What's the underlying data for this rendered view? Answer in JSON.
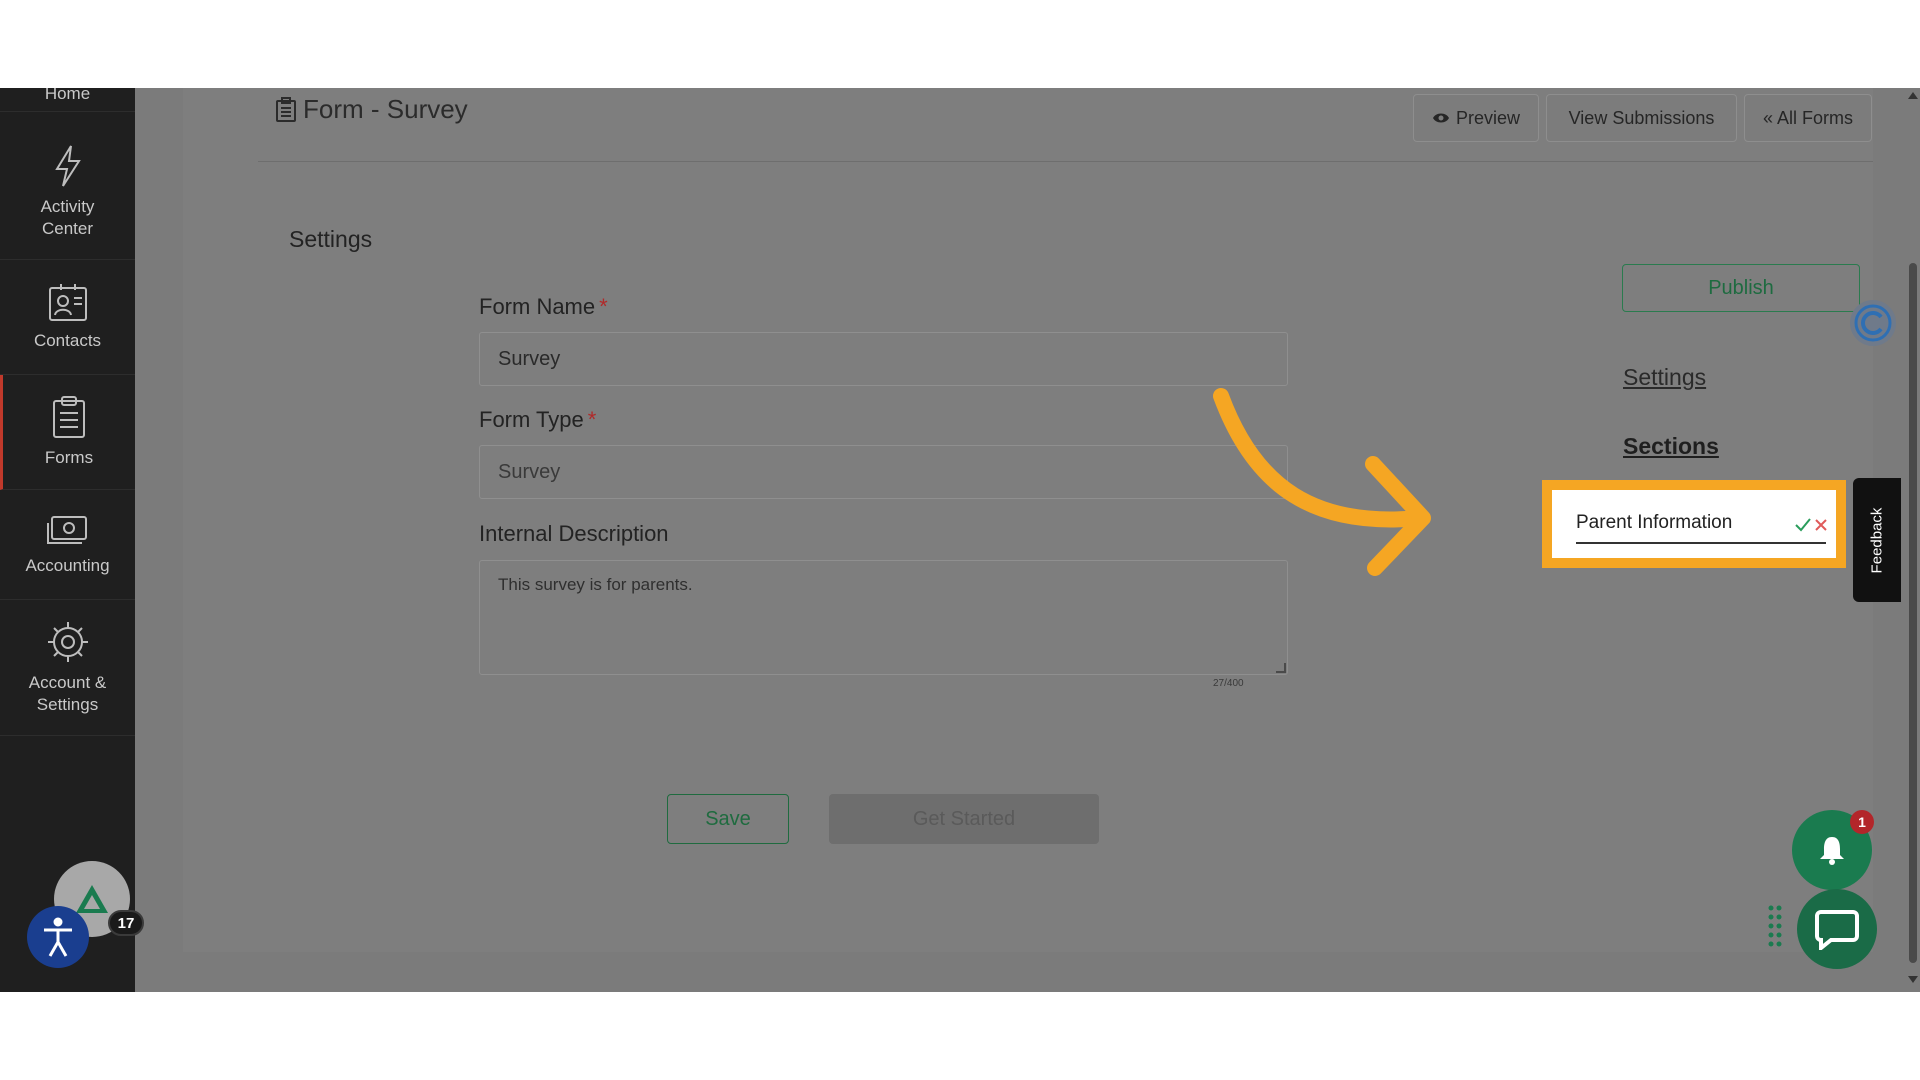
{
  "sidebar": {
    "items": [
      {
        "label": "Home"
      },
      {
        "label": "Activity Center"
      },
      {
        "label": "Contacts"
      },
      {
        "label": "Forms"
      },
      {
        "label": "Accounting"
      },
      {
        "label": "Account & Settings"
      }
    ],
    "avatar_badge": "17"
  },
  "header": {
    "title": "Form - Survey",
    "preview_label": "Preview",
    "submissions_label": "View Submissions",
    "all_forms_label": "« All Forms"
  },
  "settings": {
    "title": "Settings",
    "form_name": {
      "label": "Form Name",
      "required_mark": "*",
      "value": "Survey"
    },
    "form_type": {
      "label": "Form Type",
      "required_mark": "*",
      "value": "Survey"
    },
    "description": {
      "label": "Internal Description",
      "value": "This survey is for parents.",
      "char_count": "27/400"
    },
    "save_label": "Save",
    "get_started_label": "Get Started"
  },
  "right_panel": {
    "publish_label": "Publish",
    "settings_link": "Settings",
    "sections_link": "Sections",
    "section_input_value": "Parent Information"
  },
  "feedback_label": "Feedback",
  "notifications": {
    "count": "1"
  },
  "colors": {
    "highlight": "#f5a623",
    "accent_green": "#1a7b4f",
    "required_red": "#b02a2a",
    "sidebar_bg": "#1f1f1f"
  }
}
